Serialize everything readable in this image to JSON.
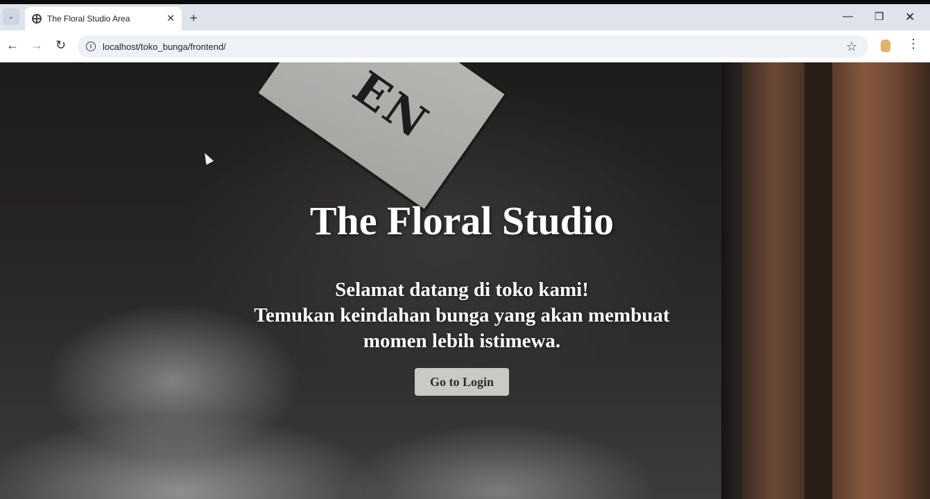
{
  "browser": {
    "tab_title": "The Floral Studio Area",
    "tab_close": "✕",
    "new_tab": "+",
    "url": "localhost/toko_bunga/frontend/",
    "icons": [
      "tab-search-icon",
      "globe-icon",
      "close-icon",
      "plus-icon",
      "minimize-icon",
      "restore-icon",
      "back-icon",
      "forward-icon",
      "reload-icon",
      "info-icon",
      "star-icon",
      "extension-icon",
      "menu-icon"
    ],
    "controls": {
      "minimize": "—",
      "restore": "❐",
      "close": "✕"
    }
  },
  "hero": {
    "sign_text": "EN",
    "title": "The Floral Studio",
    "subtitle_lines": [
      "Selamat datang di toko kami!",
      "Temukan keindahan bunga yang akan membuat",
      "momen lebih istimewa."
    ],
    "login_button": "Go to Login"
  }
}
